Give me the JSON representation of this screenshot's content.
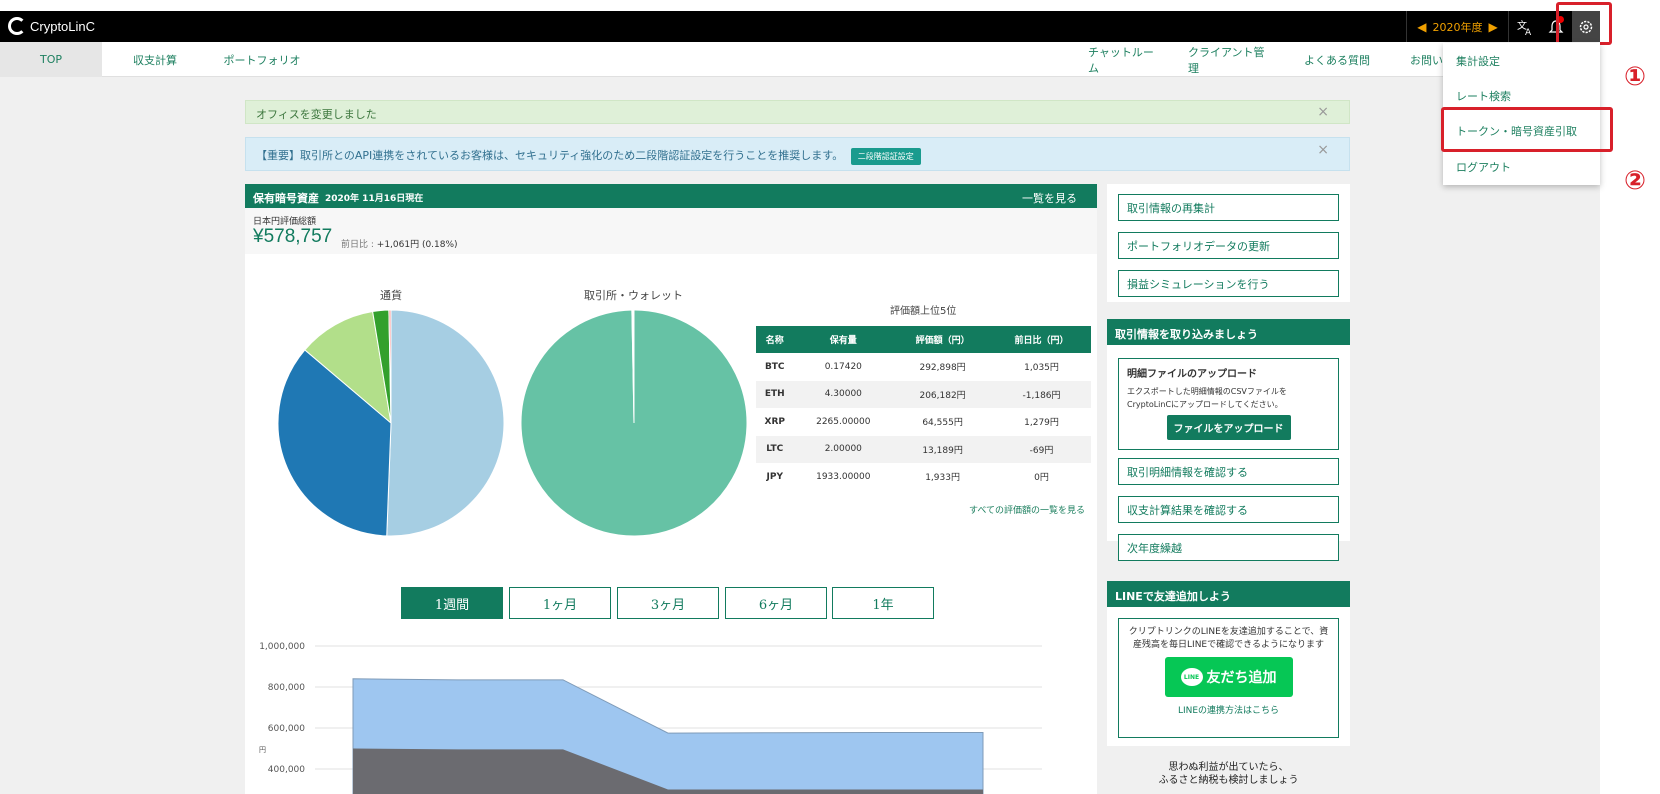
{
  "app": {
    "name": "CryptoLinC"
  },
  "topbar": {
    "year": "2020年度",
    "prev": "◀",
    "next": "▶"
  },
  "nav": {
    "left": [
      "TOP",
      "収支計算",
      "ポートフォリオ"
    ],
    "right": [
      "チャットルーム",
      "クライアント管理",
      "よくある質問",
      "お問い合"
    ]
  },
  "dropdown": {
    "items": [
      "集計設定",
      "レート検索",
      "トークン・暗号資産引取",
      "ログアウト"
    ]
  },
  "annotations": {
    "one": "①",
    "two": "②"
  },
  "alerts": {
    "office": "オフィスを変更しました",
    "security": "【重要】取引所とのAPI連携をされているお客様は、セキュリティ強化のため二段階認証設定を行うことを推奨します。",
    "security_btn": "二段階認証設定",
    "close": "×"
  },
  "holdings": {
    "title": "保有暗号資産",
    "date": "2020年 11月16日現在",
    "view_all": "一覧を見る",
    "total_label": "日本円評価総額",
    "total_value": "¥578,757",
    "change_label": "前日比 :",
    "change_value": "+1,061円 (0.18%)"
  },
  "pies": {
    "currency_title": "通貨",
    "exchange_title": "取引所・ウォレット",
    "currency_slices": [
      {
        "value": 50.6,
        "color": "#a6cee3"
      },
      {
        "value": 35.6,
        "color": "#1f78b4"
      },
      {
        "value": 11.2,
        "color": "#b2df8a"
      },
      {
        "value": 2.3,
        "color": "#33a02c"
      },
      {
        "value": 0.3,
        "color": "#fb9a99"
      }
    ],
    "exchange_slices": [
      {
        "value": 99.7,
        "color": "#66c2a5"
      },
      {
        "value": 0.3,
        "color": "#ffffff"
      }
    ]
  },
  "top5": {
    "title": "評価額上位5位",
    "headers": [
      "名称",
      "保有量",
      "評価額（円）",
      "前日比（円）"
    ],
    "rows": [
      [
        "BTC",
        "0.17420",
        "292,898円",
        "1,035円"
      ],
      [
        "ETH",
        "4.30000",
        "206,182円",
        "-1,186円"
      ],
      [
        "XRP",
        "2265.00000",
        "64,555円",
        "1,279円"
      ],
      [
        "LTC",
        "2.00000",
        "13,189円",
        "-69円"
      ],
      [
        "JPY",
        "1933.00000",
        "1,933円",
        "0円"
      ]
    ],
    "all_link": "すべての評価額の一覧を見る"
  },
  "periods": [
    "1週間",
    "1ヶ月",
    "3ヶ月",
    "6ヶ月",
    "1年"
  ],
  "chart_data": {
    "type": "area",
    "ylabel": "円",
    "y_ticks": [
      "1,000,000",
      "800,000",
      "600,000",
      "400,000"
    ],
    "ylim": [
      300000,
      1000000
    ],
    "x": [
      0,
      1,
      2,
      3,
      4,
      5,
      6
    ],
    "series": [
      {
        "values": [
          840000,
          835000,
          835000,
          575000,
          577000,
          578000,
          578000
        ],
        "color": "#9ec6f0"
      },
      {
        "values": [
          500000,
          496000,
          496000,
          300000,
          300000,
          300000,
          300000
        ],
        "color": "#6b6b70"
      }
    ]
  },
  "right": {
    "buttons_top": [
      "取引情報の再集計",
      "ポートフォリオデータの更新",
      "損益シミュレーションを行う"
    ],
    "import_head": "取引情報を取り込みましょう",
    "upload_title": "明細ファイルのアップロード",
    "upload_body": "エクスポートした明細情報のCSVファイルをCryptoLinCにアップロードしてください。",
    "upload_btn": "ファイルをアップロード",
    "buttons_mid": [
      "取引明細情報を確認する",
      "収支計算結果を確認する",
      "次年度繰越"
    ],
    "line_head": "LINEで友達追加しよう",
    "line_body": "クリプトリンクのLINEを友達追加することで、資産残高を毎日LINEで確認できるようになります",
    "line_logo": "LINE",
    "line_btn": "友だち追加",
    "line_link": "LINEの連携方法はこちら",
    "furusato_1": "思わぬ利益が出ていたら、",
    "furusato_2": "ふるさと納税も検討しましょう"
  }
}
